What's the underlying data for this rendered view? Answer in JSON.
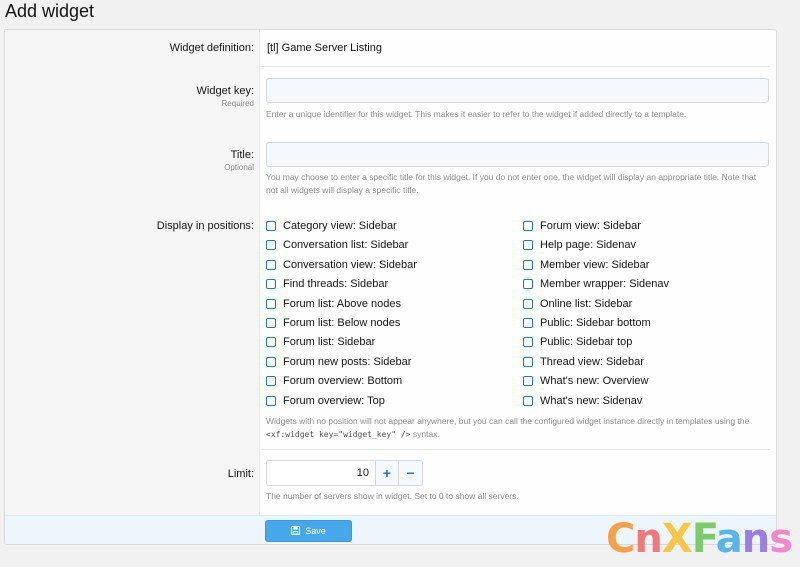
{
  "page": {
    "title": "Add widget"
  },
  "form": {
    "definition": {
      "label": "Widget definition:",
      "value": "[tl] Game Server Listing"
    },
    "widget_key": {
      "label": "Widget key:",
      "hint": "Required",
      "value": "",
      "explain": "Enter a unique identifier for this widget. This makes it easier to refer to the widget if added directly to a template."
    },
    "title": {
      "label": "Title:",
      "hint": "Optional",
      "value": "",
      "explain": "You may choose to enter a specific title for this widget. If you do not enter one, the widget will display an appropriate title. Note that not all widgets will display a specific title."
    },
    "positions": {
      "label": "Display in positions:",
      "left": [
        "Category view: Sidebar",
        "Conversation list: Sidebar",
        "Conversation view: Sidebar",
        "Find threads: Sidebar",
        "Forum list: Above nodes",
        "Forum list: Below nodes",
        "Forum list: Sidebar",
        "Forum new posts: Sidebar",
        "Forum overview: Bottom",
        "Forum overview: Top"
      ],
      "right": [
        "Forum view: Sidebar",
        "Help page: Sidenav",
        "Member view: Sidebar",
        "Member wrapper: Sidenav",
        "Online list: Sidebar",
        "Public: Sidebar bottom",
        "Public: Sidebar top",
        "Thread view: Sidebar",
        "What's new: Overview",
        "What's new: Sidenav"
      ],
      "explain_part1": "Widgets with no position will not appear anywhere, but you can call the configured widget instance directly in templates using the",
      "explain_code": "<xf:widget key=\"widget_key\" />",
      "explain_part2": "syntax."
    },
    "limit": {
      "label": "Limit:",
      "value": "10",
      "plus": "+",
      "minus": "−",
      "explain": "The number of servers show in widget. Set to 0 to show all servers."
    },
    "save_label": "Save"
  },
  "watermark": {
    "letters": [
      "C",
      "n",
      "X",
      "F",
      "a",
      "n",
      "s"
    ],
    "colors": [
      "#f5a04a",
      "#f07a7a",
      "#f5c64a",
      "#7ec96a",
      "#5ab4e8",
      "#9a7ee0",
      "#f08acb"
    ]
  },
  "icons": {
    "save": "save-icon"
  }
}
